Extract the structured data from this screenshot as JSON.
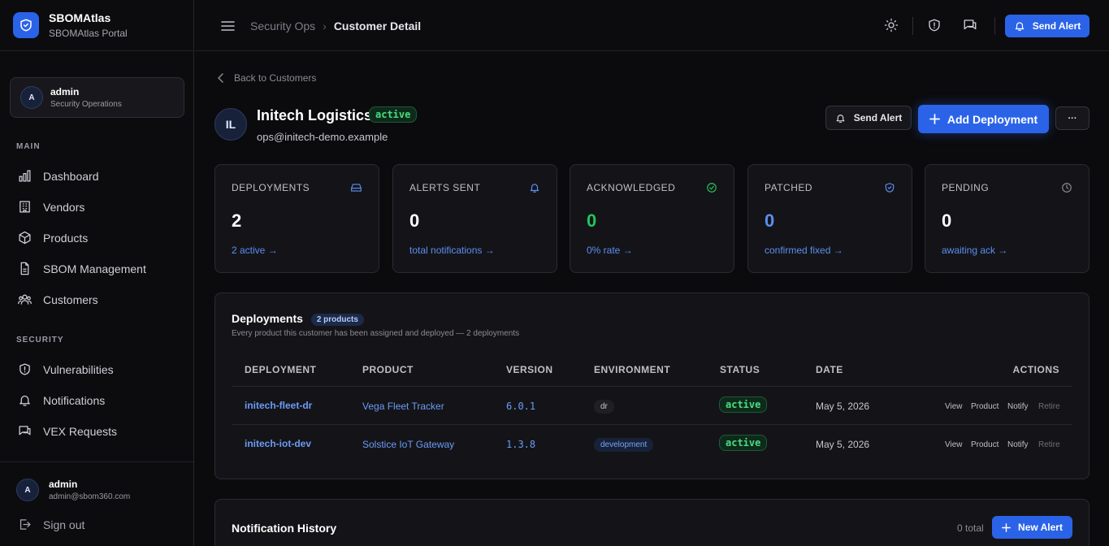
{
  "brand": {
    "name": "SBOMAtlas",
    "subtitle": "SBOMAtlas Portal"
  },
  "user_card": {
    "initial": "A",
    "name": "admin",
    "role": "Security Operations"
  },
  "nav": {
    "main_heading": "MAIN",
    "security_heading": "SECURITY",
    "items": [
      {
        "label": "Dashboard",
        "icon": "chart-icon"
      },
      {
        "label": "Vendors",
        "icon": "building-icon"
      },
      {
        "label": "Products",
        "icon": "box-icon"
      },
      {
        "label": "SBOM Management",
        "icon": "file-icon"
      },
      {
        "label": "Customers",
        "icon": "users-icon"
      },
      {
        "label": "Vulnerabilities",
        "icon": "shield-alert-icon"
      },
      {
        "label": "Notifications",
        "icon": "bell-icon"
      },
      {
        "label": "VEX Requests",
        "icon": "chat-icon"
      }
    ]
  },
  "footer": {
    "initial": "A",
    "name": "admin",
    "email": "admin@sbom360.com",
    "signout": "Sign out"
  },
  "topbar": {
    "breadcrumb_parent": "Security Ops",
    "breadcrumb_current": "Customer Detail",
    "send_alert": "Send Alert"
  },
  "customer": {
    "back_label": "Back to Customers",
    "initials": "IL",
    "name": "Initech Logistics",
    "status": "active",
    "email": "ops@initech-demo.example",
    "send_alert": "Send Alert",
    "add_deployment": "Add Deployment",
    "more": "···"
  },
  "stats": [
    {
      "label": "DEPLOYMENTS",
      "value": "2",
      "sub": "2 active →",
      "icon": "hard-drive-icon",
      "color": "#ffffff"
    },
    {
      "label": "ALERTS SENT",
      "value": "0",
      "sub": "total notifications →",
      "icon": "bell-icon",
      "color": "#ffffff"
    },
    {
      "label": "ACKNOWLEDGED",
      "value": "0",
      "sub": "0% rate →",
      "icon": "check-circle-icon",
      "color": "#22c55e"
    },
    {
      "label": "PATCHED",
      "value": "0",
      "sub": "confirmed fixed →",
      "icon": "shield-check-icon",
      "color": "#5b8ef0"
    },
    {
      "label": "PENDING",
      "value": "0",
      "sub": "awaiting ack →",
      "icon": "clock-icon",
      "color": "#ffffff"
    }
  ],
  "deployments": {
    "title": "Deployments",
    "count_chip": "2 products",
    "subtitle": "Every product this customer has been assigned and deployed — 2 deployments",
    "headers": [
      "DEPLOYMENT",
      "PRODUCT",
      "VERSION",
      "ENVIRONMENT",
      "STATUS",
      "DATE",
      "ACTIONS"
    ],
    "rows": [
      {
        "deployment": "initech-fleet-dr",
        "product": "Vega Fleet Tracker",
        "version": "6.0.1",
        "environment": "dr",
        "status": "active",
        "date": "May 5, 2026",
        "actions": [
          "View",
          "Product",
          "Notify",
          "Retire"
        ]
      },
      {
        "deployment": "initech-iot-dev",
        "product": "Solstice IoT Gateway",
        "version": "1.3.8",
        "environment": "development",
        "status": "active",
        "date": "May 5, 2026",
        "actions": [
          "View",
          "Product",
          "Notify",
          "Retire"
        ]
      }
    ]
  },
  "notifications": {
    "title": "Notification History",
    "total": "0 total",
    "new_alert": "New Alert"
  }
}
